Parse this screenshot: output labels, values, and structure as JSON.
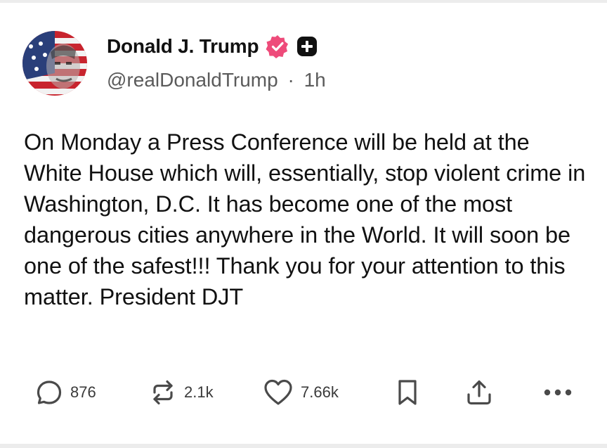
{
  "post": {
    "author": {
      "display_name": "Donald J. Trump",
      "handle": "@realDonaldTrump",
      "separator": "·",
      "time": "1h",
      "verified_icon": "verified-badge-icon",
      "plus_icon": "plus-badge-icon"
    },
    "text": "On Monday a Press Conference will be held at the White House which will, essentially, stop violent crime in Washington, D.C. It has become one of the most dangerous cities anywhere in the World. It will soon be one of the safest!!! Thank you for your attention to this matter. President DJT",
    "actions": {
      "replies": "876",
      "reposts": "2.1k",
      "likes": "7.66k"
    }
  },
  "colors": {
    "verified": "#ee4b7a",
    "text": "#111111",
    "muted": "#5b5b5b",
    "icon": "#4a4a4a"
  }
}
